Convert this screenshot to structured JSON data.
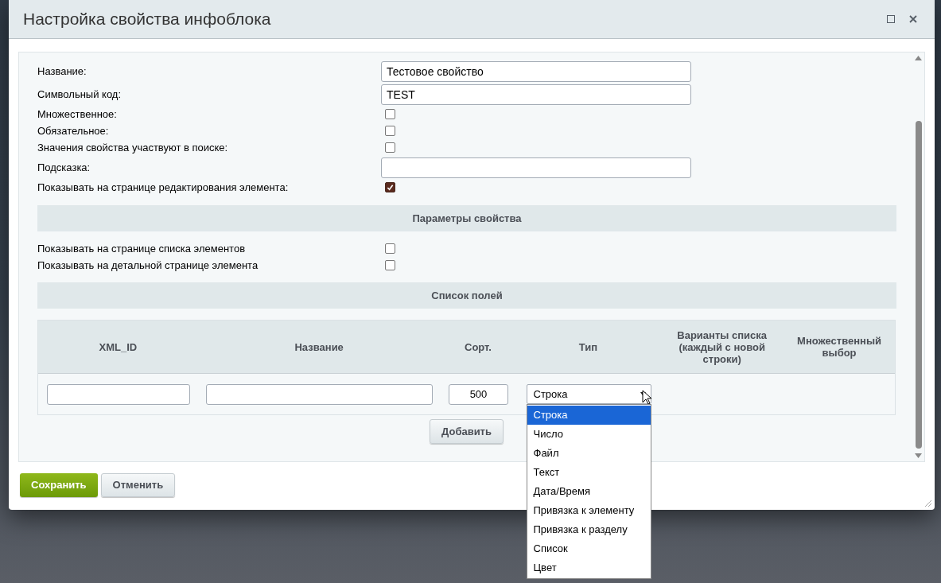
{
  "window": {
    "title": "Настройка свойства инфоблока"
  },
  "fields": [
    {
      "kind": "text",
      "label": "Название:",
      "value": "Тестовое свойство"
    },
    {
      "kind": "text",
      "label": "Символьный код:",
      "value": "TEST"
    },
    {
      "kind": "checkbox",
      "label": "Множественное:",
      "checked": false
    },
    {
      "kind": "checkbox",
      "label": "Обязательное:",
      "checked": false
    },
    {
      "kind": "checkbox",
      "label": "Значения свойства участвуют в поиске:",
      "checked": false
    },
    {
      "kind": "text",
      "label": "Подсказка:"
    },
    {
      "kind": "checkbox",
      "label": "Показывать на странице редактирования элемента:",
      "checked": true
    }
  ],
  "params_section": {
    "title": "Параметры свойства",
    "fields": [
      {
        "kind": "checkbox",
        "label": "Показывать на странице списка элементов",
        "checked": false
      },
      {
        "kind": "checkbox",
        "label": "Показывать на детальной странице элемента",
        "checked": false
      }
    ]
  },
  "list_section": {
    "title": "Список полей",
    "table": {
      "columns": [
        "XML_ID",
        "Название",
        "Сорт.",
        "Тип",
        "Варианты списка (каждый с новой строки)",
        "Множественный выбор"
      ],
      "rows": [
        {
          "sort": "500",
          "type": {
            "value": "Строка",
            "expanded": true,
            "options": [
              {
                "label": "Строка",
                "selected": true
              },
              {
                "label": "Число",
                "selected": false
              },
              {
                "label": "Файл",
                "selected": false
              },
              {
                "label": "Текст",
                "selected": false
              },
              {
                "label": "Дата/Время",
                "selected": false
              },
              {
                "label": "Привязка к элементу",
                "selected": false
              },
              {
                "label": "Привязка к разделу",
                "selected": false
              },
              {
                "label": "Список",
                "selected": false
              },
              {
                "label": "Цвет",
                "selected": false
              }
            ]
          }
        }
      ]
    },
    "add_button": "Добавить"
  },
  "buttons": [
    {
      "kind": "primary",
      "label": "Сохранить"
    },
    {
      "kind": "secondary",
      "label": "Отменить"
    }
  ]
}
